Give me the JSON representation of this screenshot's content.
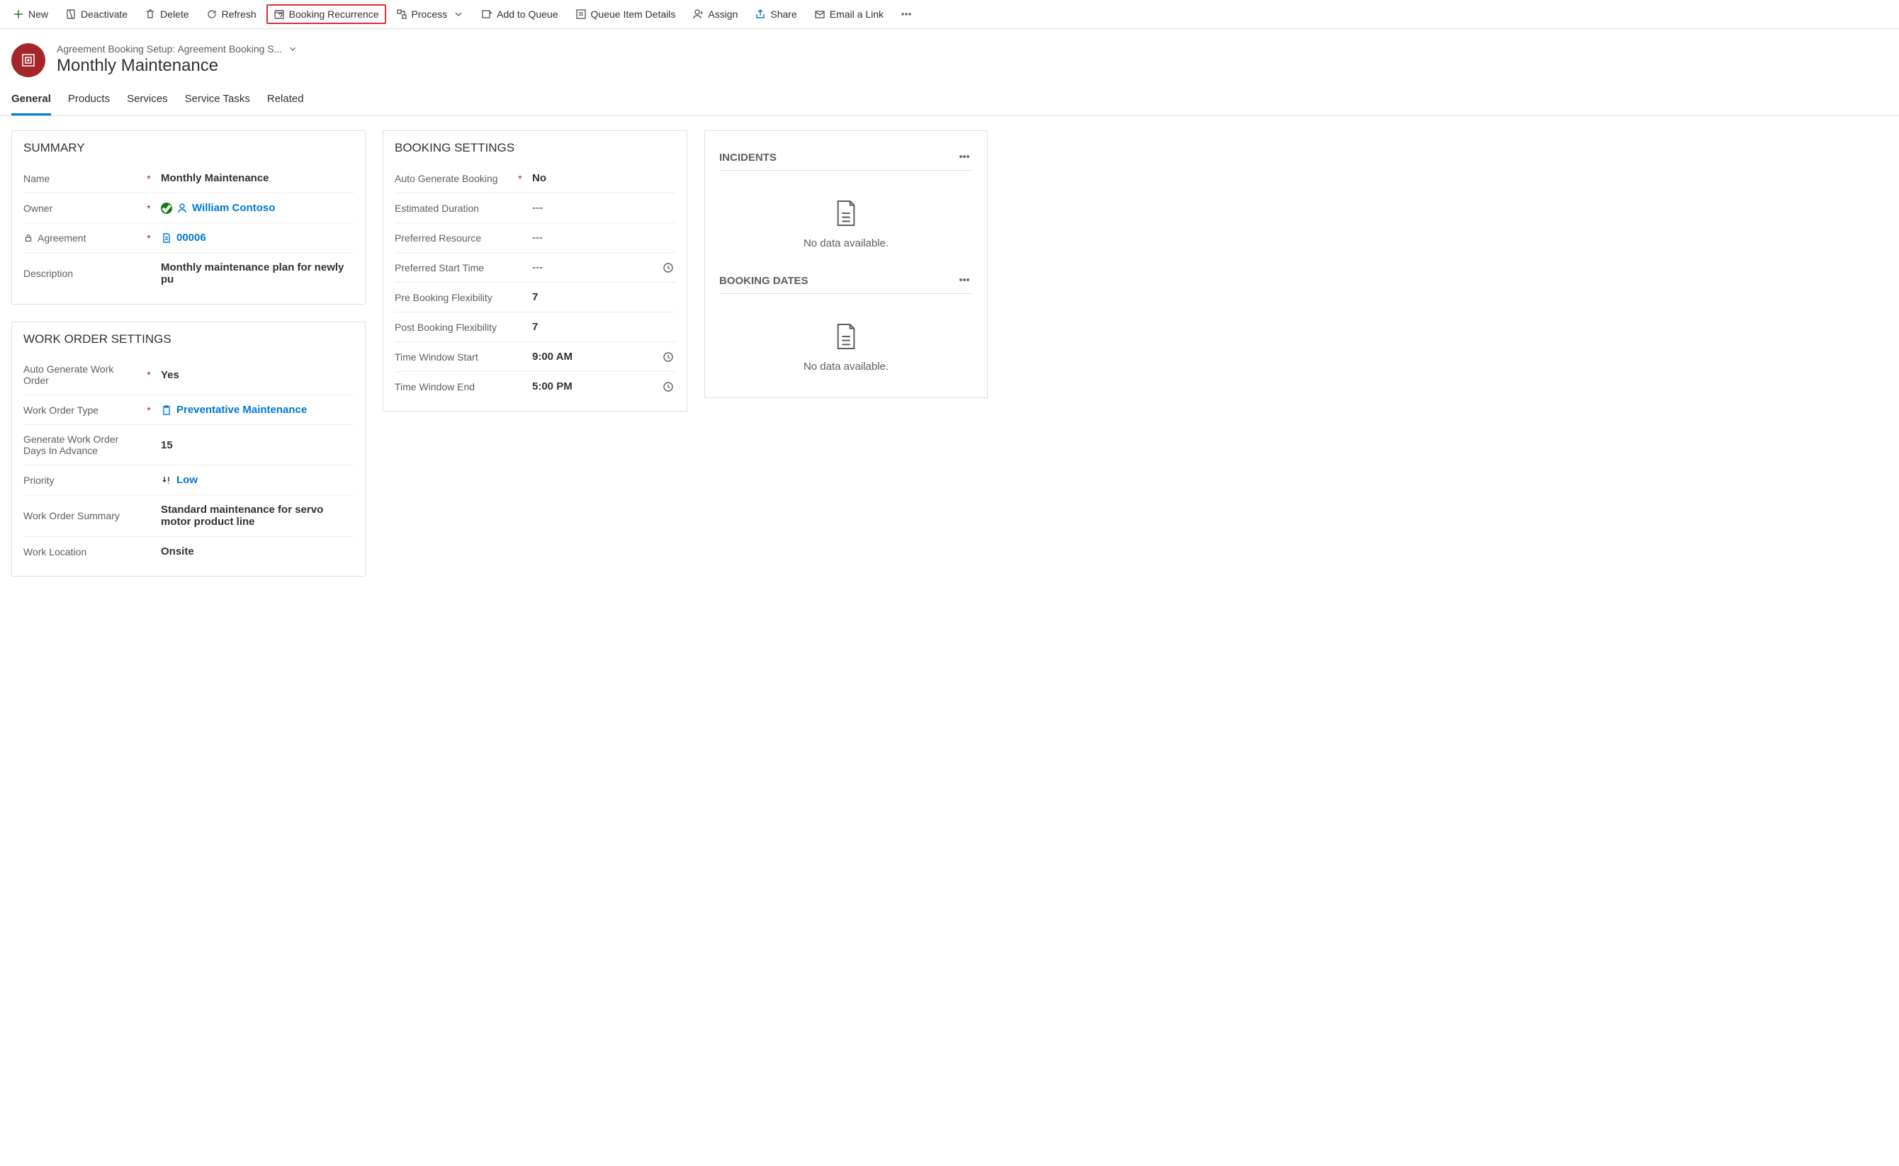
{
  "commandBar": {
    "new": "New",
    "deactivate": "Deactivate",
    "delete": "Delete",
    "refresh": "Refresh",
    "bookingRecurrence": "Booking Recurrence",
    "process": "Process",
    "addToQueue": "Add to Queue",
    "queueItemDetails": "Queue Item Details",
    "assign": "Assign",
    "share": "Share",
    "emailLink": "Email a Link"
  },
  "header": {
    "breadcrumb": "Agreement Booking Setup: Agreement Booking S...",
    "title": "Monthly Maintenance"
  },
  "tabs": {
    "general": "General",
    "products": "Products",
    "services": "Services",
    "serviceTasks": "Service Tasks",
    "related": "Related"
  },
  "summary": {
    "sectionTitle": "SUMMARY",
    "nameLabel": "Name",
    "nameValue": "Monthly Maintenance",
    "ownerLabel": "Owner",
    "ownerValue": "William Contoso",
    "agreementLabel": "Agreement",
    "agreementValue": "00006",
    "descriptionLabel": "Description",
    "descriptionValue": "Monthly maintenance plan for newly pu"
  },
  "workOrder": {
    "sectionTitle": "WORK ORDER SETTINGS",
    "autoGenLabel": "Auto Generate Work Order",
    "autoGenValue": "Yes",
    "typeLabel": "Work Order Type",
    "typeValue": "Preventative Maintenance",
    "daysAdvanceLabel": "Generate Work Order Days In Advance",
    "daysAdvanceValue": "15",
    "priorityLabel": "Priority",
    "priorityValue": "Low",
    "summaryLabel": "Work Order Summary",
    "summaryValue": "Standard maintenance for servo motor product line",
    "locationLabel": "Work Location",
    "locationValue": "Onsite"
  },
  "booking": {
    "sectionTitle": "BOOKING SETTINGS",
    "autoGenLabel": "Auto Generate Booking",
    "autoGenValue": "No",
    "durationLabel": "Estimated Duration",
    "durationValue": "---",
    "resourceLabel": "Preferred Resource",
    "resourceValue": "---",
    "startTimeLabel": "Preferred Start Time",
    "startTimeValue": "---",
    "preFlexLabel": "Pre Booking Flexibility",
    "preFlexValue": "7",
    "postFlexLabel": "Post Booking Flexibility",
    "postFlexValue": "7",
    "windowStartLabel": "Time Window Start",
    "windowStartValue": "9:00 AM",
    "windowEndLabel": "Time Window End",
    "windowEndValue": "5:00 PM"
  },
  "side": {
    "incidentsTitle": "INCIDENTS",
    "bookingDatesTitle": "BOOKING DATES",
    "noData": "No data available."
  }
}
